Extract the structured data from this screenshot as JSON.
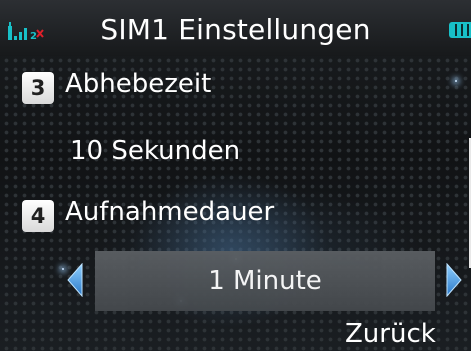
{
  "status_bar": {
    "title": "SIM1 Einstellungen",
    "signal_icon": "signal-strength-icon",
    "battery_icon": "battery-icon",
    "accent_color": "#18c0c8",
    "alert_color": "#e0202a"
  },
  "settings": {
    "items": [
      {
        "number": "3",
        "label": "Abhebezeit",
        "value": "10 Sekunden"
      },
      {
        "number": "4",
        "label": "Aufnahmedauer",
        "value": "1 Minute"
      }
    ]
  },
  "softkeys": {
    "right_label": "Zurück"
  }
}
